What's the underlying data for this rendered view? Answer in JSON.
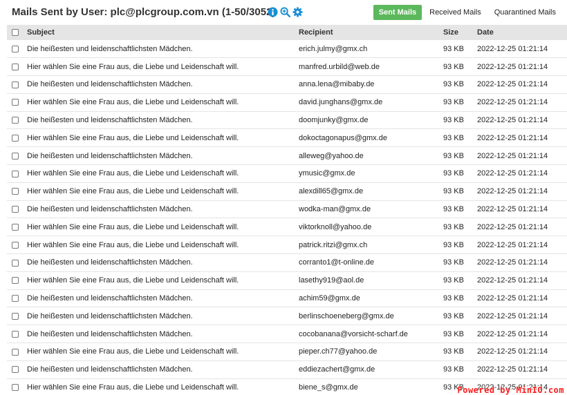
{
  "header": {
    "title": "Mails Sent by User: plc@plcgroup.com.vn (1-50/3052)",
    "icons": [
      "info-icon",
      "zoom-icon",
      "gear-icon"
    ],
    "accent_color": "#1a8fd4"
  },
  "tabs": [
    {
      "label": "Sent Mails",
      "active": true
    },
    {
      "label": "Received Mails",
      "active": false
    },
    {
      "label": "Quarantined Mails",
      "active": false
    }
  ],
  "table": {
    "columns": [
      "Subject",
      "Recipient",
      "Size",
      "Date"
    ],
    "rows": [
      {
        "subject": "Die heißesten und leidenschaftlichsten Mädchen.",
        "recipient": "erich.julmy@gmx.ch",
        "size": "93 KB",
        "date": "2022-12-25 01:21:14"
      },
      {
        "subject": "Hier wählen Sie eine Frau aus, die Liebe und Leidenschaft will.",
        "recipient": "manfred.urbild@web.de",
        "size": "93 KB",
        "date": "2022-12-25 01:21:14"
      },
      {
        "subject": "Die heißesten und leidenschaftlichsten Mädchen.",
        "recipient": "anna.lena@mibaby.de",
        "size": "93 KB",
        "date": "2022-12-25 01:21:14"
      },
      {
        "subject": "Hier wählen Sie eine Frau aus, die Liebe und Leidenschaft will.",
        "recipient": "david.junghans@gmx.de",
        "size": "93 KB",
        "date": "2022-12-25 01:21:14"
      },
      {
        "subject": "Die heißesten und leidenschaftlichsten Mädchen.",
        "recipient": "doomjunky@gmx.de",
        "size": "93 KB",
        "date": "2022-12-25 01:21:14"
      },
      {
        "subject": "Hier wählen Sie eine Frau aus, die Liebe und Leidenschaft will.",
        "recipient": "dokoctagonapus@gmx.de",
        "size": "93 KB",
        "date": "2022-12-25 01:21:14"
      },
      {
        "subject": "Die heißesten und leidenschaftlichsten Mädchen.",
        "recipient": "alleweg@yahoo.de",
        "size": "93 KB",
        "date": "2022-12-25 01:21:14"
      },
      {
        "subject": "Hier wählen Sie eine Frau aus, die Liebe und Leidenschaft will.",
        "recipient": "ymusic@gmx.de",
        "size": "93 KB",
        "date": "2022-12-25 01:21:14"
      },
      {
        "subject": "Hier wählen Sie eine Frau aus, die Liebe und Leidenschaft will.",
        "recipient": "alexdill65@gmx.de",
        "size": "93 KB",
        "date": "2022-12-25 01:21:14"
      },
      {
        "subject": "Die heißesten und leidenschaftlichsten Mädchen.",
        "recipient": "wodka-man@gmx.de",
        "size": "93 KB",
        "date": "2022-12-25 01:21:14"
      },
      {
        "subject": "Hier wählen Sie eine Frau aus, die Liebe und Leidenschaft will.",
        "recipient": "viktorknoll@yahoo.de",
        "size": "93 KB",
        "date": "2022-12-25 01:21:14"
      },
      {
        "subject": "Hier wählen Sie eine Frau aus, die Liebe und Leidenschaft will.",
        "recipient": "patrick.ritzi@gmx.ch",
        "size": "93 KB",
        "date": "2022-12-25 01:21:14"
      },
      {
        "subject": "Die heißesten und leidenschaftlichsten Mädchen.",
        "recipient": "corranto1@t-online.de",
        "size": "93 KB",
        "date": "2022-12-25 01:21:14"
      },
      {
        "subject": "Hier wählen Sie eine Frau aus, die Liebe und Leidenschaft will.",
        "recipient": "lasethy919@aol.de",
        "size": "93 KB",
        "date": "2022-12-25 01:21:14"
      },
      {
        "subject": "Die heißesten und leidenschaftlichsten Mädchen.",
        "recipient": "achim59@gmx.de",
        "size": "93 KB",
        "date": "2022-12-25 01:21:14"
      },
      {
        "subject": "Die heißesten und leidenschaftlichsten Mädchen.",
        "recipient": "berlinschoeneberg@gmx.de",
        "size": "93 KB",
        "date": "2022-12-25 01:21:14"
      },
      {
        "subject": "Die heißesten und leidenschaftlichsten Mädchen.",
        "recipient": "cocobanana@vorsicht-scharf.de",
        "size": "93 KB",
        "date": "2022-12-25 01:21:14"
      },
      {
        "subject": "Hier wählen Sie eine Frau aus, die Liebe und Leidenschaft will.",
        "recipient": "pieper.ch77@yahoo.de",
        "size": "93 KB",
        "date": "2022-12-25 01:21:14"
      },
      {
        "subject": "Die heißesten und leidenschaftlichsten Mädchen.",
        "recipient": "eddiezachert@gmx.de",
        "size": "93 KB",
        "date": "2022-12-25 01:21:14"
      },
      {
        "subject": "Hier wählen Sie eine Frau aus, die Liebe und Leidenschaft will.",
        "recipient": "biene_s@gmx.de",
        "size": "93 KB",
        "date": "2022-12-25 01:21:14"
      }
    ]
  },
  "watermark": {
    "text": "Powered by MinIO.com",
    "color": "#ff1a1a"
  }
}
